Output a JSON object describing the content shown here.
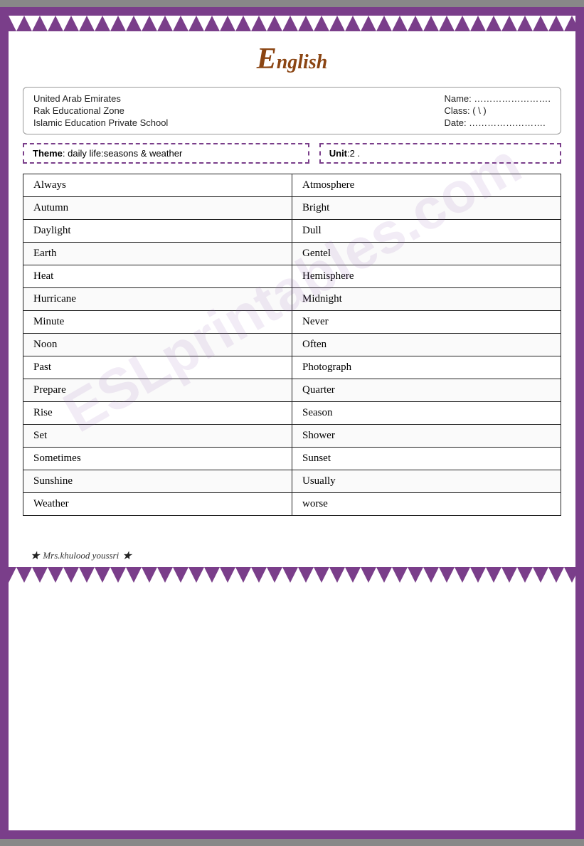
{
  "header": {
    "letter": "E",
    "rest": "nglish"
  },
  "info": {
    "left_line1": "United Arab Emirates",
    "left_line2": "Rak Educational Zone",
    "left_line3": "Islamic Education Private School",
    "right_line1": "Name:  …………………….",
    "right_line2": "Class:  (    \\    )",
    "right_line3": "Date:  ……………………."
  },
  "theme": {
    "label": "Theme",
    "colon": ":",
    "value": " daily life:seasons & weather"
  },
  "unit": {
    "label": "Unit",
    "colon": ":",
    "value": "2 ."
  },
  "vocabulary": {
    "words": [
      [
        "Always",
        "Atmosphere"
      ],
      [
        "Autumn",
        "Bright"
      ],
      [
        "Daylight",
        "Dull"
      ],
      [
        "Earth",
        "Gentel"
      ],
      [
        "Heat",
        "Hemisphere"
      ],
      [
        "Hurricane",
        "Midnight"
      ],
      [
        "Minute",
        "Never"
      ],
      [
        "Noon",
        "Often"
      ],
      [
        "Past",
        "Photograph"
      ],
      [
        "Prepare",
        "Quarter"
      ],
      [
        "Rise",
        "Season"
      ],
      [
        "Set",
        "Shower"
      ],
      [
        "Sometimes",
        "Sunset"
      ],
      [
        "Sunshine",
        "Usually"
      ],
      [
        "Weather",
        "worse"
      ]
    ]
  },
  "footer": {
    "text": "Mrs.khulood youssri"
  },
  "watermark": "ESLprintables.com"
}
